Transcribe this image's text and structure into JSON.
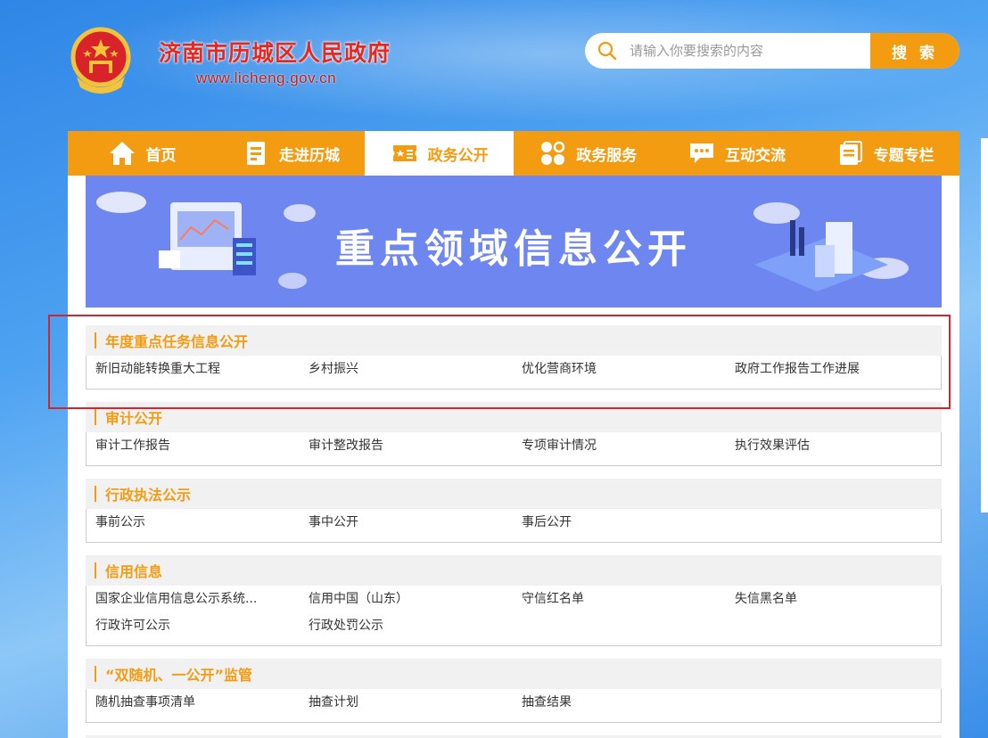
{
  "header": {
    "site_title": "济南市历城区人民政府",
    "site_url": "www.licheng.gov.cn",
    "search_placeholder": "请输入你要搜索的内容",
    "search_button": "搜 索"
  },
  "nav": [
    {
      "label": "首页",
      "icon": "home-icon"
    },
    {
      "label": "走进历城",
      "icon": "document-icon"
    },
    {
      "label": "政务公开",
      "icon": "ticket-icon",
      "active": true
    },
    {
      "label": "政务服务",
      "icon": "grid-icon"
    },
    {
      "label": "互动交流",
      "icon": "chat-icon"
    },
    {
      "label": "专题专栏",
      "icon": "notes-icon"
    }
  ],
  "banner": {
    "title": "重点领域信息公开"
  },
  "sections": [
    {
      "title": "年度重点任务信息公开",
      "links": [
        "新旧动能转换重大工程",
        "乡村振兴",
        "优化营商环境",
        "政府工作报告工作进展"
      ]
    },
    {
      "title": "审计公开",
      "links": [
        "审计工作报告",
        "审计整改报告",
        "专项审计情况",
        "执行效果评估"
      ]
    },
    {
      "title": "行政执法公示",
      "links": [
        "事前公示",
        "事中公开",
        "事后公开"
      ]
    },
    {
      "title": "信用信息",
      "links": [
        "国家企业信用信息公示系统...",
        "信用中国（山东）",
        "守信红名单",
        "失信黑名单",
        "行政许可公示",
        "行政处罚公示"
      ]
    },
    {
      "title": "“双随机、一公开”监管",
      "links": [
        "随机抽查事项清单",
        "抽查计划",
        "抽查结果"
      ]
    }
  ],
  "colors": {
    "accent": "#f39c12",
    "highlight": "#d9232a",
    "title_red": "#e8281f"
  }
}
